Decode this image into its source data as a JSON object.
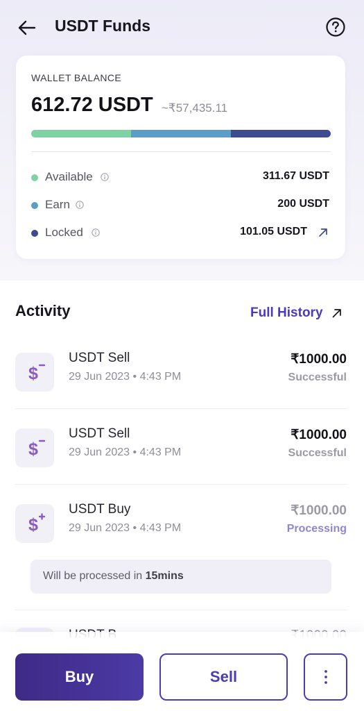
{
  "header": {
    "title": "USDT Funds",
    "back_icon": "arrow-left-icon",
    "help_icon": "question-circle-icon"
  },
  "wallet": {
    "label": "WALLET BALANCE",
    "balance": "612.72 USDT",
    "balance_inr": "~₹57,435.11",
    "breakdown": [
      {
        "label": "Available",
        "value": "311.67 USDT",
        "color": "#7dd3a3",
        "share": 0.3333
      },
      {
        "label": "Earn",
        "value": "200 USDT",
        "color": "#5a9dc9",
        "share": 0.3333
      },
      {
        "label": "Locked",
        "value": "101.05 USDT",
        "color": "#3d4b92",
        "share": 0.3334
      }
    ]
  },
  "activity": {
    "title": "Activity",
    "full_history_label": "Full History",
    "transactions": [
      {
        "title": "USDT Sell",
        "date": "29 Jun 2023 • 4:43 PM",
        "amount": "₹1000.00",
        "status": "Successful",
        "type": "sell"
      },
      {
        "title": "USDT Sell",
        "date": "29 Jun 2023 • 4:43 PM",
        "amount": "₹1000.00",
        "status": "Successful",
        "type": "sell"
      },
      {
        "title": "USDT Buy",
        "date": "29 Jun 2023 • 4:43 PM",
        "amount": "₹1000.00",
        "status": "Processing",
        "type": "buy"
      }
    ],
    "notice": {
      "prefix": "Will be processed in ",
      "highlight": "15mins"
    },
    "partial": {
      "title": "USDT B",
      "amount": "₹1000.00"
    }
  },
  "actions": {
    "buy_label": "Buy",
    "sell_label": "Sell",
    "more_icon": "more-vertical-icon"
  },
  "colors": {
    "accent": "#4a3bb9",
    "buy_gradient_start": "#3e2a86",
    "processing": "#8d86d6"
  }
}
